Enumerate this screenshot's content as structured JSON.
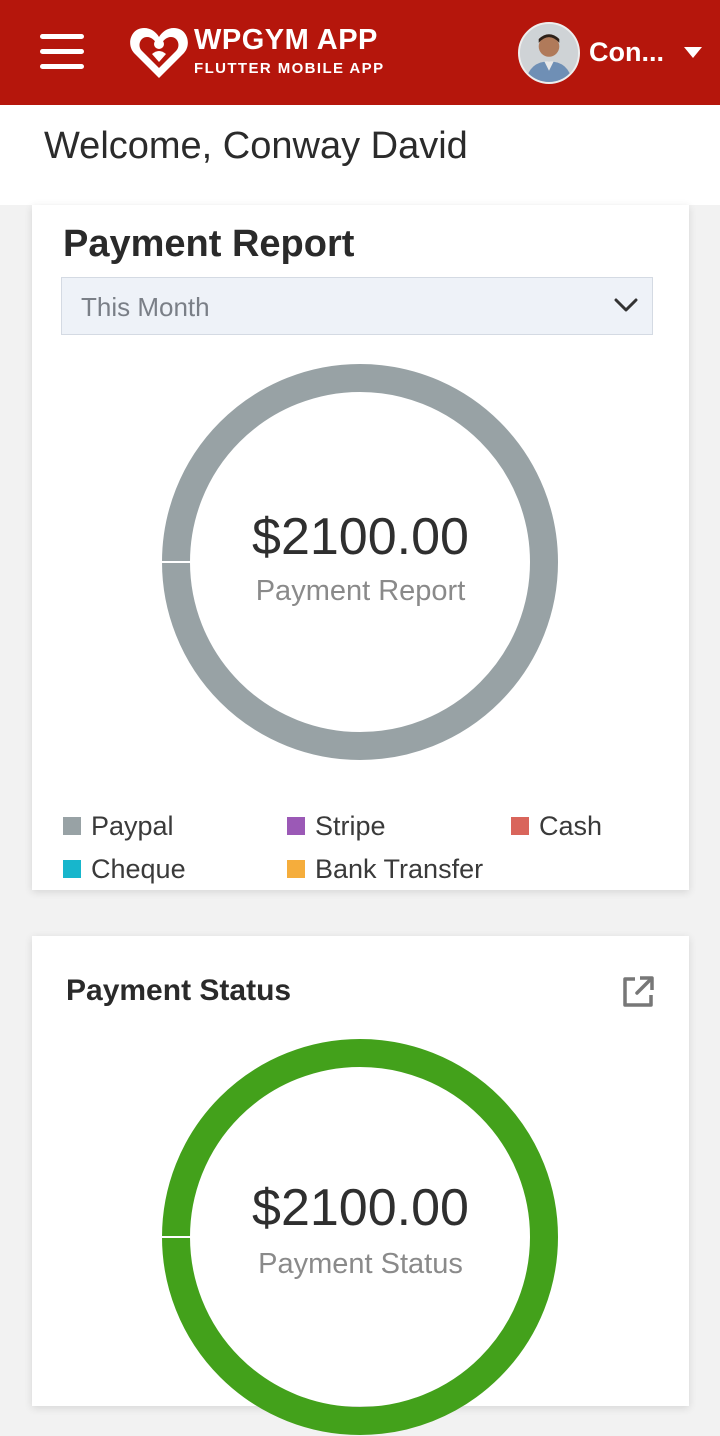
{
  "header": {
    "app_title": "WPGYM APP",
    "app_subtitle": "FLUTTER MOBILE APP",
    "user_name": "Con...",
    "brand_color": "#b5160c",
    "icons": [
      "menu-icon",
      "logo-icon",
      "avatar",
      "caret-down-icon"
    ]
  },
  "welcome": {
    "text": "Welcome, Conway David"
  },
  "payment_report": {
    "title": "Payment Report",
    "filter": {
      "selected": "This Month"
    },
    "amount": "$2100.00",
    "center_label": "Payment Report",
    "ring_color": "#98a2a5",
    "legend": [
      {
        "label": "Paypal",
        "color": "#98a2a5"
      },
      {
        "label": "Stripe",
        "color": "#9b59b6"
      },
      {
        "label": "Cash",
        "color": "#d9655b"
      },
      {
        "label": "Cheque",
        "color": "#17b6cc"
      },
      {
        "label": "Bank Transfer",
        "color": "#f5ad3c"
      }
    ]
  },
  "payment_status": {
    "title": "Payment Status",
    "amount": "$2100.00",
    "center_label": "Payment Status",
    "ring_color": "#43a11b"
  }
}
